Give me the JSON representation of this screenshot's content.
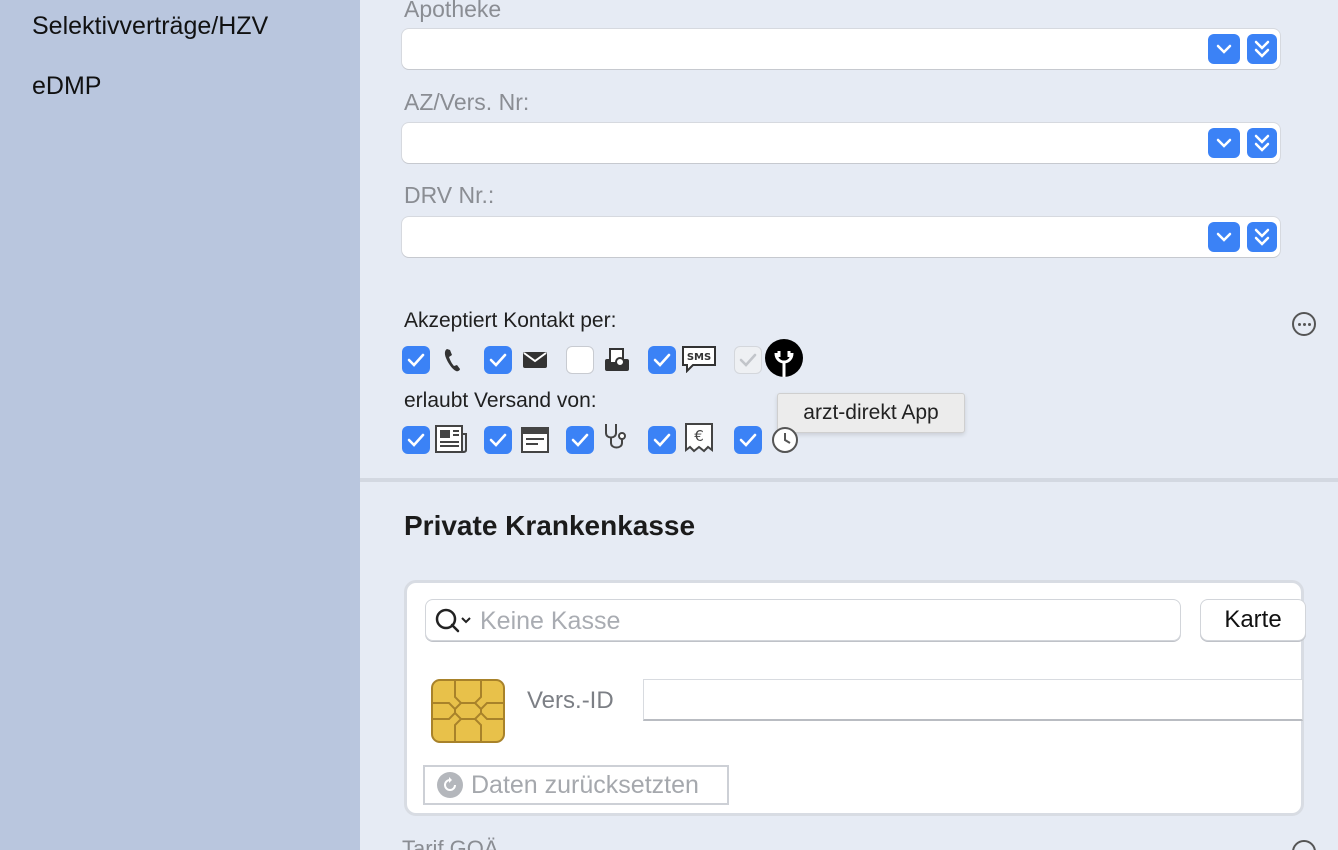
{
  "sidebar": {
    "items": [
      {
        "label": "Selektivverträge/HZV"
      },
      {
        "label": "eDMP"
      }
    ]
  },
  "fields": {
    "apotheke_label": "Apotheke",
    "apotheke_value": "",
    "az_label": "AZ/Vers. Nr:",
    "az_value": "",
    "drv_label": "DRV Nr.:",
    "drv_value": ""
  },
  "contact": {
    "label": "Akzeptiert Kontakt per:",
    "options": [
      {
        "icon": "phone-icon",
        "checked": true
      },
      {
        "icon": "mail-icon",
        "checked": true
      },
      {
        "icon": "fax-icon",
        "checked": false
      },
      {
        "icon": "sms-icon",
        "checked": true
      },
      {
        "icon": "arzt-direkt-app-icon",
        "checked": true,
        "disabled": true
      }
    ]
  },
  "tooltip": "arzt-direkt App",
  "dispatch": {
    "label": "erlaubt Versand von:",
    "options": [
      {
        "icon": "newspaper-icon",
        "checked": true
      },
      {
        "icon": "calendar-icon",
        "checked": true
      },
      {
        "icon": "stethoscope-icon",
        "checked": true
      },
      {
        "icon": "invoice-euro-icon",
        "checked": true
      },
      {
        "icon": "reminder-clock-icon",
        "checked": true
      }
    ]
  },
  "pkv": {
    "title": "Private Krankenkasse",
    "search_placeholder": "Keine Kasse",
    "card_button": "Karte",
    "vers_id_label": "Vers.-ID",
    "vers_id_value": "",
    "reset_label": "Daten zurücksetzten"
  },
  "tarif_label": "Tarif GOÄ",
  "colors": {
    "accent": "#3b82f6",
    "sidebar_bg": "#b9c6de",
    "main_bg": "#e6ebf4",
    "chip_gold": "#e8c14a"
  }
}
